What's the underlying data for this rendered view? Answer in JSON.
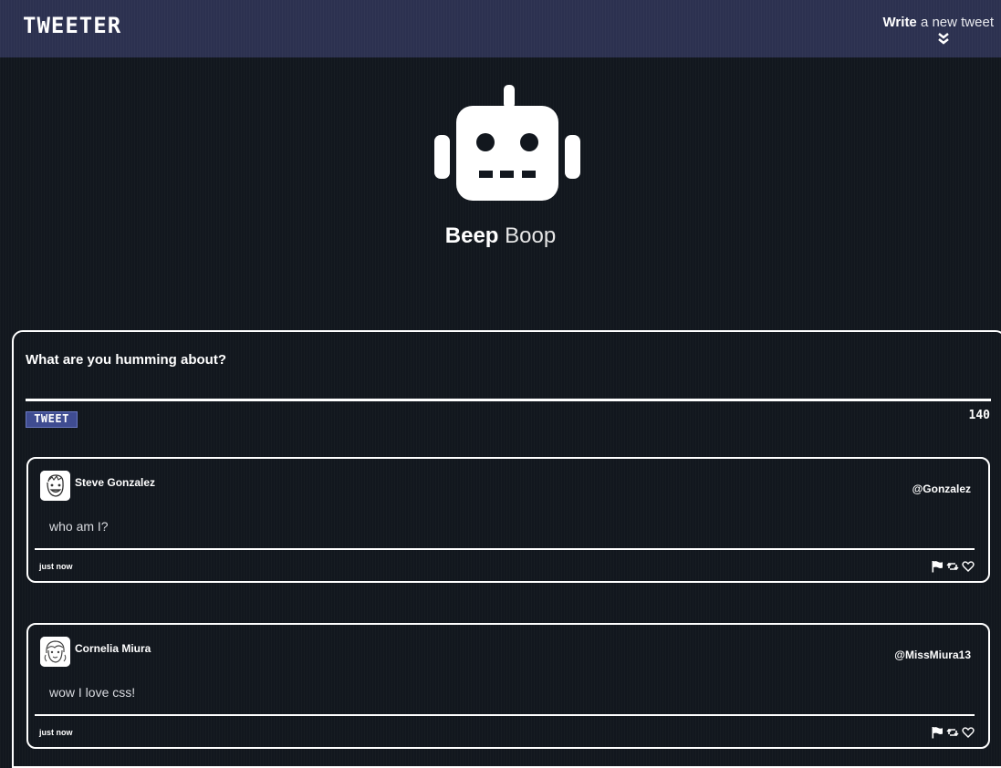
{
  "nav": {
    "brand": "TWEETER",
    "compose_bold": "Write",
    "compose_rest": " a new tweet",
    "chevron_icon": "double-chevron-down-icon"
  },
  "profile": {
    "avatar_icon": "robot-icon",
    "first_name": "Beep",
    "last_name": "Boop"
  },
  "compose": {
    "label": "What are you humming about?",
    "input_value": "",
    "button_label": "TWEET",
    "counter": "140"
  },
  "tweets": [
    {
      "name": "Steve Gonzalez",
      "handle": "@Gonzalez",
      "text": "who am I?",
      "time": "just now",
      "actions": [
        "flag-icon",
        "retweet-icon",
        "heart-icon"
      ]
    },
    {
      "name": "Cornelia Miura",
      "handle": "@MissMiura13",
      "text": "wow I love css!",
      "time": "just now",
      "actions": [
        "flag-icon",
        "retweet-icon",
        "heart-icon"
      ]
    }
  ],
  "colors": {
    "background": "#12171e",
    "navbar": "#2c3150",
    "button": "#3f4c91",
    "text": "#ffffff"
  }
}
